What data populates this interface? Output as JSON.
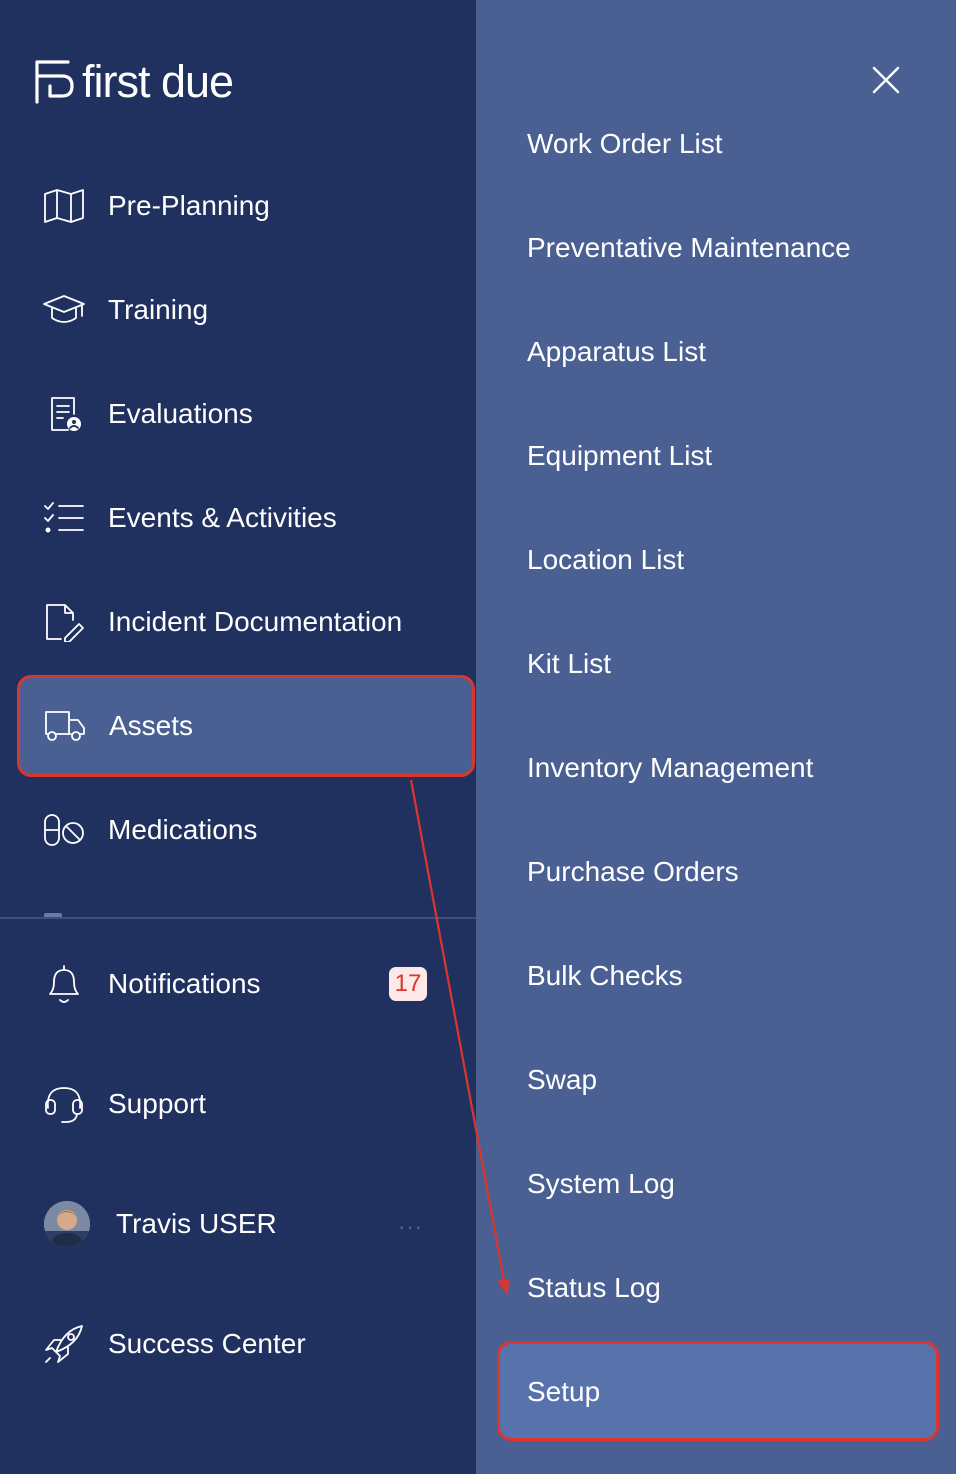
{
  "app": {
    "logo_text": "first due"
  },
  "sidebar": {
    "items": [
      {
        "label": "Pre-Planning",
        "icon": "map-icon"
      },
      {
        "label": "Training",
        "icon": "graduation-cap-icon"
      },
      {
        "label": "Evaluations",
        "icon": "evaluation-document-icon"
      },
      {
        "label": "Events & Activities",
        "icon": "checklist-icon"
      },
      {
        "label": "Incident Documentation",
        "icon": "document-edit-icon"
      },
      {
        "label": "Assets",
        "icon": "truck-icon",
        "active": true
      },
      {
        "label": "Medications",
        "icon": "pills-icon"
      }
    ],
    "notifications": {
      "label": "Notifications",
      "count": "17",
      "icon": "bell-icon"
    },
    "support": {
      "label": "Support",
      "icon": "headset-icon"
    },
    "user": {
      "name": "Travis USER",
      "menu": "···"
    },
    "success_center": {
      "label": "Success Center",
      "icon": "rocket-icon"
    }
  },
  "submenu": {
    "close_icon": "close-icon",
    "items": [
      "Work Order List",
      "Preventative Maintenance",
      "Apparatus List",
      "Equipment List",
      "Location List",
      "Kit List",
      "Inventory Management",
      "Purchase Orders",
      "Bulk Checks",
      "Swap",
      "System Log",
      "Status Log",
      "Setup"
    ],
    "active_item": "Setup"
  },
  "colors": {
    "sidebar_bg": "#20305f",
    "submenu_bg": "#4a6093",
    "highlight_border": "#d9362f",
    "badge_bg": "#fde7e7",
    "badge_text": "#d9362f"
  }
}
